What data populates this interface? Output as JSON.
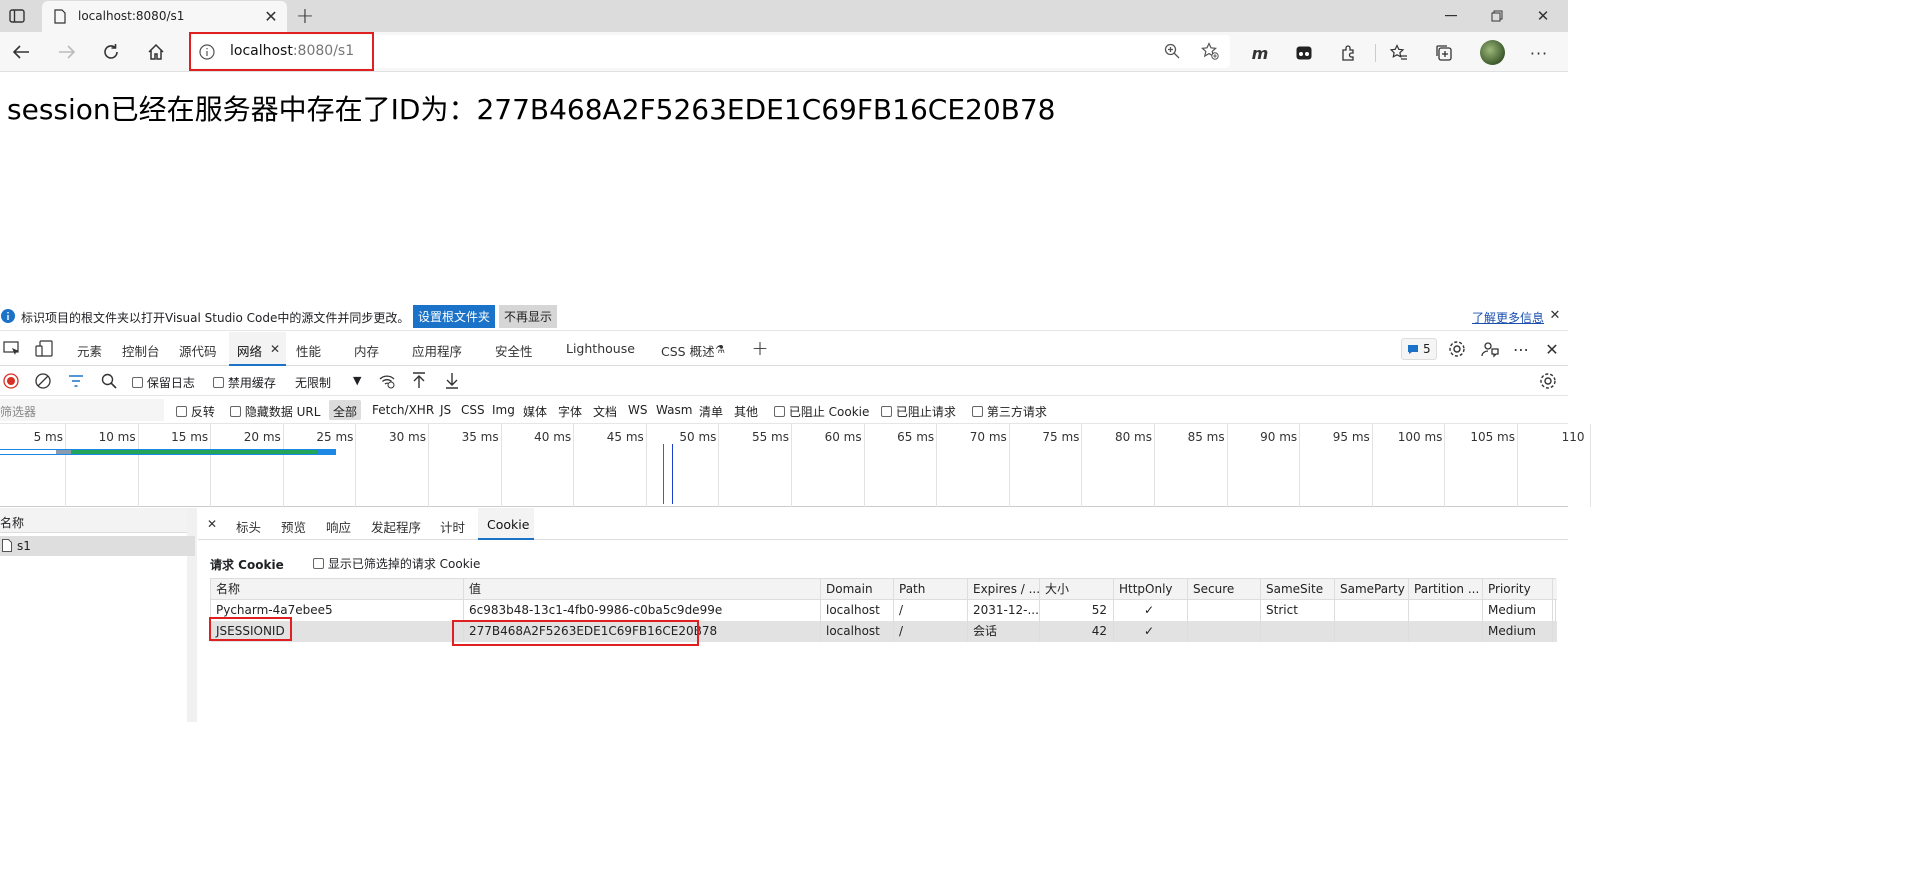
{
  "browser": {
    "tab_title": "localhost:8080/s1",
    "url_host": "localhost",
    "url_rest": ":8080/s1"
  },
  "page": {
    "headline": "session已经在服务器中存在了ID为：277B468A2F5263EDE1C69FB16CE20B78"
  },
  "infobar": {
    "message": "标识项目的根文件夹以打开Visual Studio Code中的源文件并同步更改。",
    "primary_button": "设置根文件夹",
    "secondary_button": "不再显示",
    "learn_more": "了解更多信息"
  },
  "devtools": {
    "tabs": [
      "元素",
      "控制台",
      "源代码",
      "网络",
      "性能",
      "内存",
      "应用程序",
      "安全性",
      "Lighthouse",
      "CSS 概述"
    ],
    "active_tab": "网络",
    "issues_count": "5",
    "network_toolbar": {
      "preserve_log": "保留日志",
      "disable_cache": "禁用缓存",
      "throttling": "无限制"
    },
    "filter": {
      "placeholder": "筛选器",
      "invert": "反转",
      "hide_data_urls": "隐藏数据 URL",
      "types": [
        "全部",
        "Fetch/XHR",
        "JS",
        "CSS",
        "Img",
        "媒体",
        "字体",
        "文档",
        "WS",
        "Wasm",
        "清单",
        "其他"
      ],
      "blocked_cookies": "已阻止 Cookie",
      "blocked_requests": "已阻止请求",
      "third_party": "第三方请求"
    },
    "timeline_ticks": [
      "5 ms",
      "10 ms",
      "15 ms",
      "20 ms",
      "25 ms",
      "30 ms",
      "35 ms",
      "40 ms",
      "45 ms",
      "50 ms",
      "55 ms",
      "60 ms",
      "65 ms",
      "70 ms",
      "75 ms",
      "80 ms",
      "85 ms",
      "90 ms",
      "95 ms",
      "100 ms",
      "105 ms",
      "110"
    ],
    "requests": {
      "header": "名称",
      "items": [
        "s1"
      ]
    },
    "detail_tabs": [
      "标头",
      "预览",
      "响应",
      "发起程序",
      "计时",
      "Cookie"
    ],
    "active_detail_tab": "Cookie",
    "cookies": {
      "section_title": "请求 Cookie",
      "show_filtered": "显示已筛选掉的请求 Cookie",
      "columns": [
        "名称",
        "值",
        "Domain",
        "Path",
        "Expires / ...",
        "大小",
        "HttpOnly",
        "Secure",
        "SameSite",
        "SameParty",
        "Partition ...",
        "Priority"
      ],
      "rows": [
        [
          "Pycharm-4a7ebee5",
          "6c983b48-13c1-4fb0-9986-c0ba5c9de99e",
          "localhost",
          "/",
          "2031-12-...",
          "52",
          "✓",
          "",
          "Strict",
          "",
          "",
          "Medium"
        ],
        [
          "JSESSIONID",
          "277B468A2F5263EDE1C69FB16CE20B78",
          "localhost",
          "/",
          "会话",
          "42",
          "✓",
          "",
          "",
          "",
          "",
          "Medium"
        ]
      ]
    }
  },
  "colors": {
    "highlight_red": "#e02020",
    "accent_blue": "#1a73c9",
    "record_red": "#d93025"
  }
}
